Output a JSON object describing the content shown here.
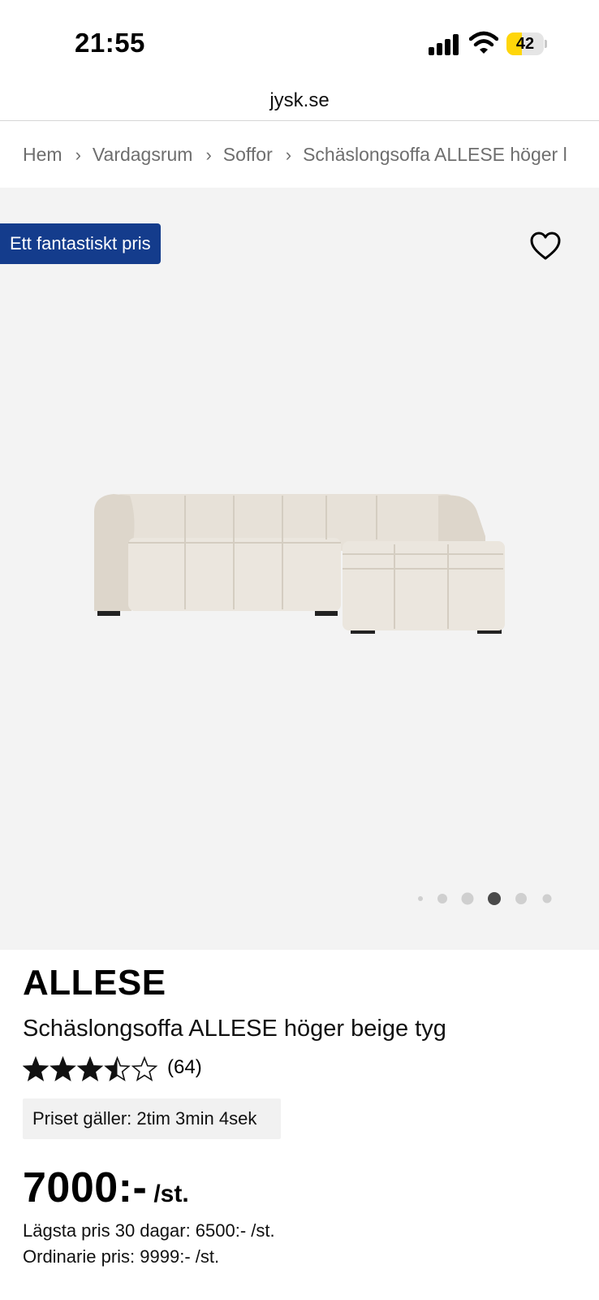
{
  "status_bar": {
    "time": "21:55",
    "battery_level": "42",
    "battery_color": "#ffd60a",
    "icons": [
      "signal-icon",
      "wifi-icon",
      "battery-icon"
    ]
  },
  "browser": {
    "url": "jysk.se"
  },
  "breadcrumb": {
    "separator": "›",
    "items": [
      "Hem",
      "Vardagsrum",
      "Soffor",
      "Schäslongsoffa ALLESE höger l"
    ]
  },
  "gallery": {
    "badge": "Ett fantastiskt pris",
    "badge_color": "#143c8c",
    "favorite_icon": "heart-outline-icon",
    "image": "sofa-product-image",
    "dots_count": 6,
    "active_dot_index": 3
  },
  "product": {
    "brand": "ALLESE",
    "title": "Schäslongsoffa ALLESE höger beige tyg",
    "rating_value": 3.5,
    "rating_max": 5,
    "rating_count": "(64)",
    "timer_text": "Priset gäller: 2tim 3min 4sek",
    "price": "7000:-",
    "price_unit": "/st.",
    "lowest_price": "Lägsta pris 30 dagar: 6500:- /st.",
    "regular_price": "Ordinarie pris: 9999:- /st."
  }
}
